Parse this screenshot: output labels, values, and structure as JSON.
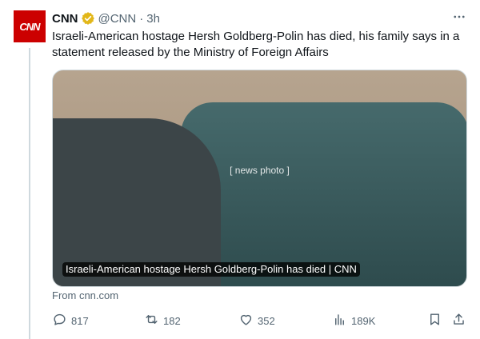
{
  "account": {
    "avatar_text": "CNN",
    "name": "CNN",
    "handle": "@CNN",
    "separator": "·",
    "time": "3h",
    "brand_color": "#cc0000",
    "verified_color": "#e2b719"
  },
  "tweet": {
    "text": "Israeli-American hostage Hersh Goldberg-Polin has died, his family says in a statement released by the Ministry of Foreign Affairs"
  },
  "media": {
    "caption": "Israeli-American hostage Hersh Goldberg-Polin has died | CNN"
  },
  "source": "From cnn.com",
  "actions": {
    "reply": {
      "icon": "reply-icon",
      "count": "817"
    },
    "retweet": {
      "icon": "retweet-icon",
      "count": "182"
    },
    "like": {
      "icon": "heart-icon",
      "count": "352"
    },
    "views": {
      "icon": "views-icon",
      "count": "189K"
    },
    "bookmark": {
      "icon": "bookmark-icon"
    },
    "share": {
      "icon": "share-icon"
    }
  }
}
